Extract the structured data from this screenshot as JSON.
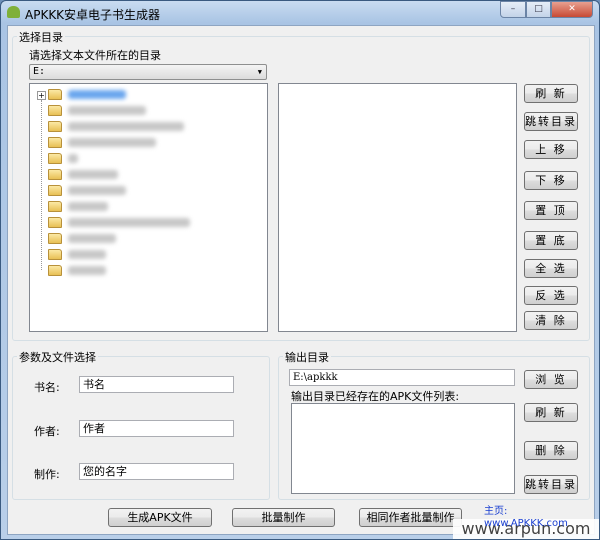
{
  "window": {
    "title": "APKKK安卓电子书生成器",
    "min": "–",
    "max": "□",
    "close": "✕"
  },
  "select_dir": {
    "group_label": "选择目录",
    "prompt": "请选择文本文件所在的目录",
    "drive": "E:",
    "dropdown_arrow": "▼",
    "expand": "+",
    "buttons": [
      "刷 新",
      "跳转目录",
      "上 移",
      "下 移",
      "置 顶",
      "置 底",
      "全 选",
      "反 选",
      "清 除"
    ]
  },
  "params": {
    "group_label": "参数及文件选择",
    "book_label": "书名:",
    "book_value": "书名",
    "author_label": "作者:",
    "author_value": "作者",
    "maker_label": "制作:",
    "maker_value": "您的名字"
  },
  "output": {
    "group_label": "输出目录",
    "path": "E:\\apkkk",
    "list_label": "输出目录已经存在的APK文件列表:",
    "browse": "浏 览",
    "refresh": "刷 新",
    "delete": "删 除",
    "goto": "跳转目录"
  },
  "bottom": {
    "generate": "生成APK文件",
    "batch": "批量制作",
    "same_author_batch": "相同作者批量制作",
    "homepage": "主页: www.APKKK.com"
  },
  "watermark": "www.arpun.com"
}
